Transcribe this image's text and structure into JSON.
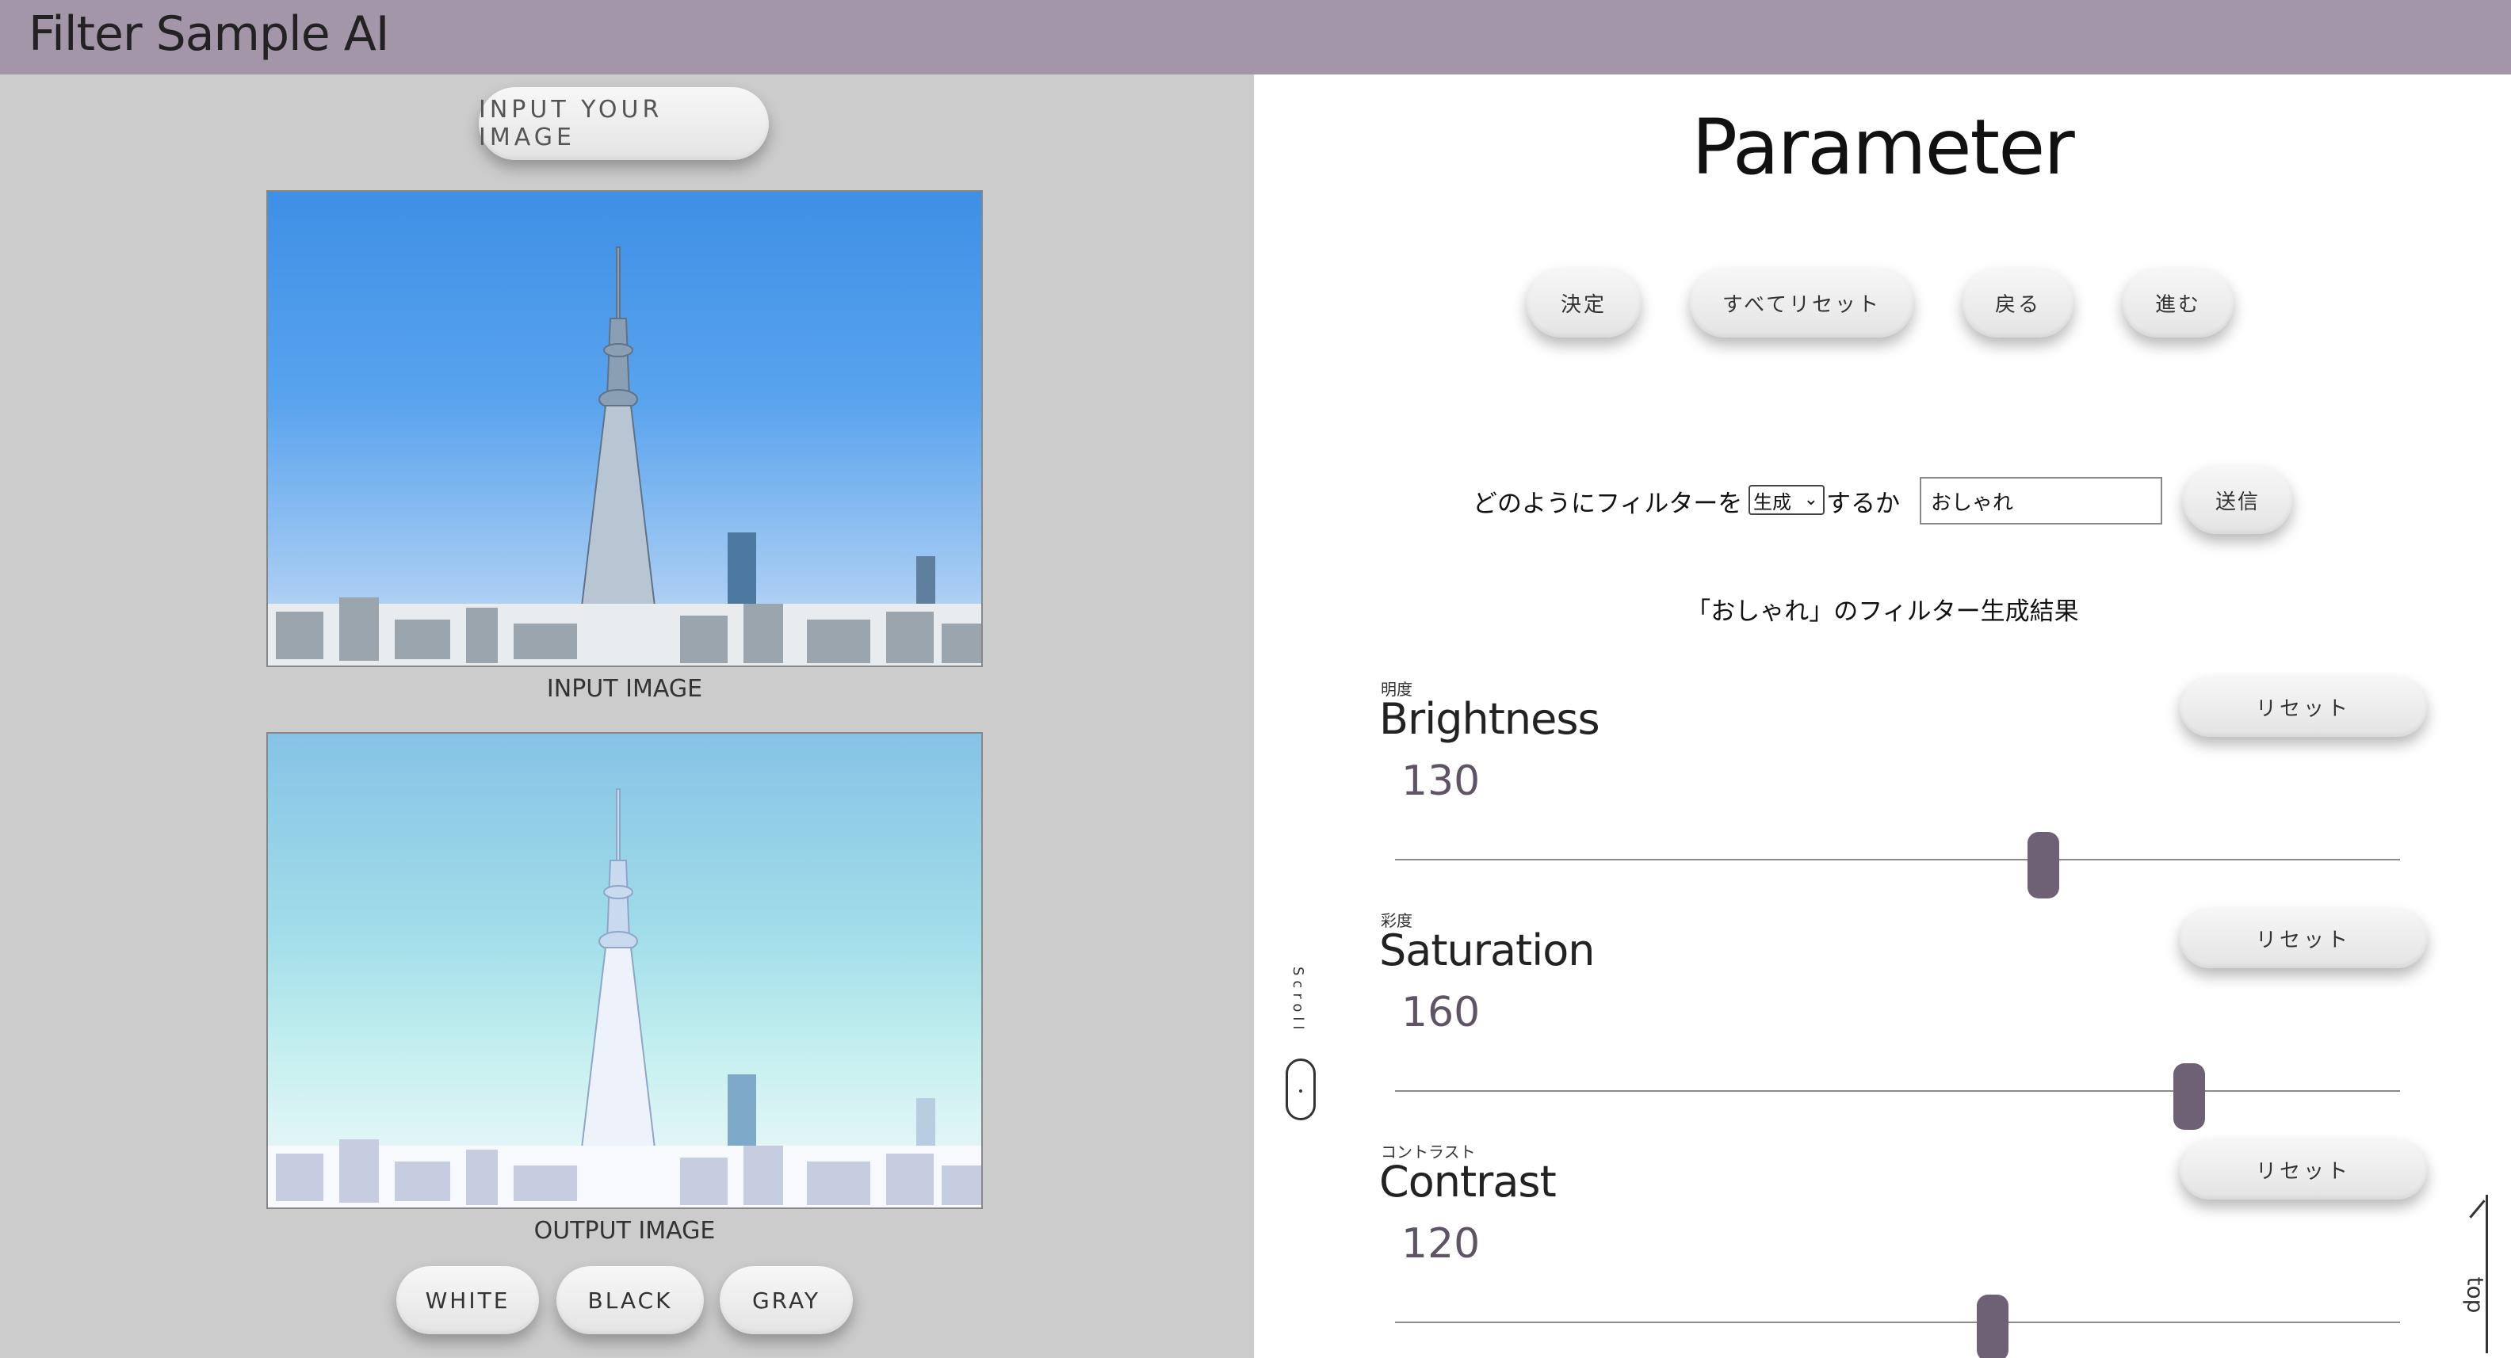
{
  "header": {
    "title": "Filter Sample AI"
  },
  "left": {
    "input_button": "INPUT YOUR IMAGE",
    "input_caption": "INPUT IMAGE",
    "output_caption": "OUTPUT IMAGE",
    "bg_buttons": {
      "white": "WHITE",
      "black": "BLACK",
      "gray": "GRAY"
    }
  },
  "right": {
    "title": "Parameter",
    "actions": {
      "decide": "決定",
      "reset_all": "すべてリセット",
      "back": "戻る",
      "next": "進む"
    },
    "filter_query": {
      "prefix": "どのようにフィルターを",
      "select_value": "生成",
      "suffix": "するか",
      "input_value": "おしゃれ",
      "send_label": "送信"
    },
    "result_text": "「おしゃれ」のフィルター生成結果",
    "params": {
      "brightness": {
        "jp": "明度",
        "en": "Brightness",
        "value": "130",
        "reset": "リセット",
        "level": 0.645
      },
      "saturation": {
        "jp": "彩度",
        "en": "Saturation",
        "value": "160",
        "reset": "リセット",
        "level": 0.79
      },
      "contrast": {
        "jp": "コントラスト",
        "en": "Contrast",
        "value": "120",
        "reset": "リセット",
        "level": 0.595
      }
    },
    "scroll_label": "Scroll",
    "top_label": "top"
  },
  "colors": {
    "header": "#a396a8",
    "left_bg": "#cccccc",
    "thumb": "#6f6175"
  }
}
